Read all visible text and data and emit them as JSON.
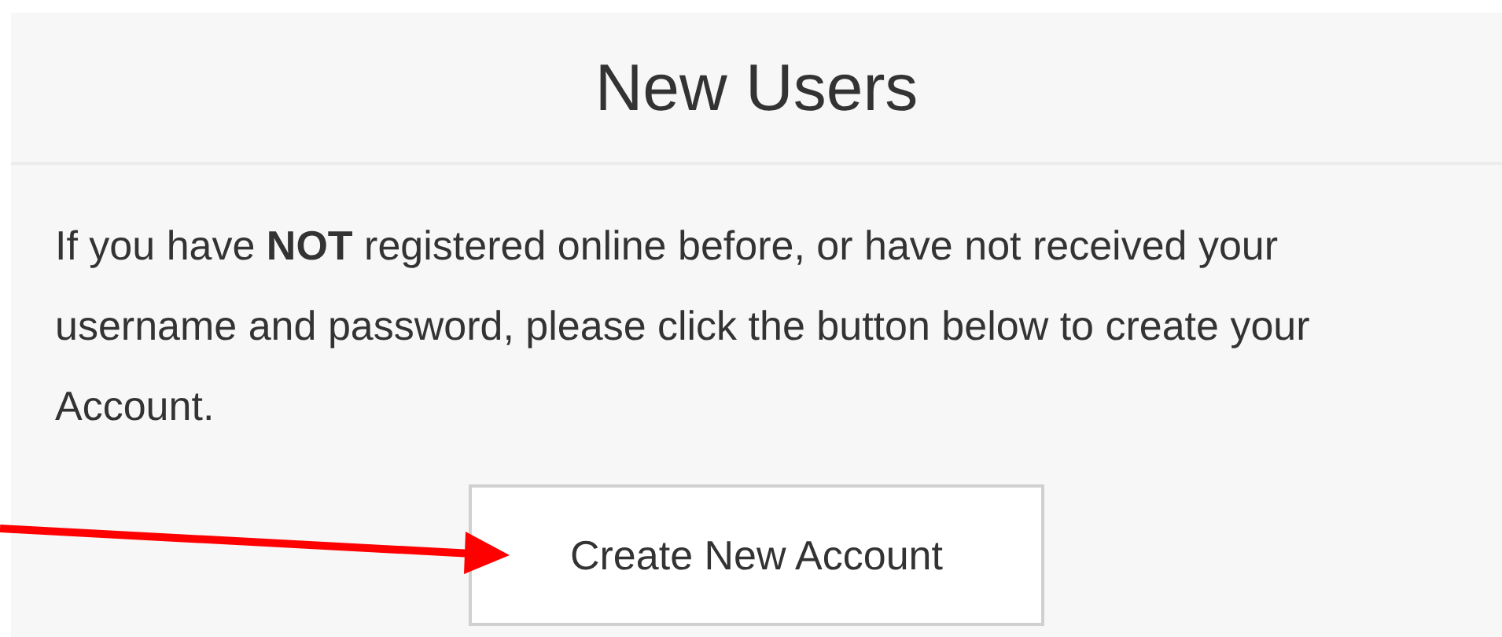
{
  "panel": {
    "title": "New Users",
    "message": "If you have **NOT** registered online before, or have not received your username and password, please click the button below to create your Account.",
    "button": "Create New Account"
  }
}
